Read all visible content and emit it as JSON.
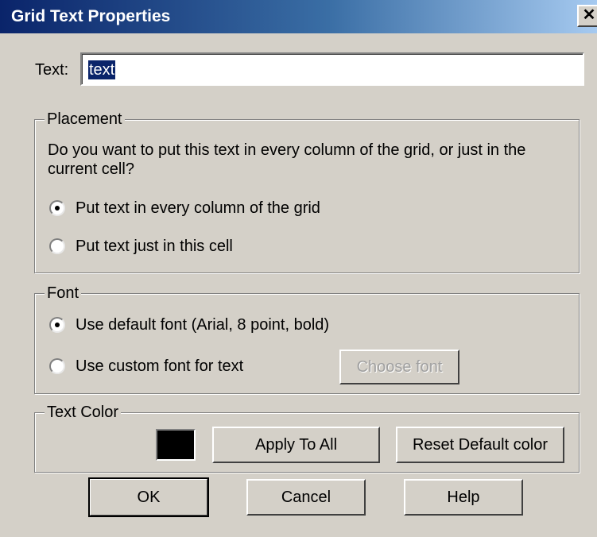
{
  "window": {
    "title": "Grid Text Properties",
    "close_glyph": "✕"
  },
  "text_field": {
    "label": "Text:",
    "value": "text"
  },
  "placement": {
    "title": "Placement",
    "question": [
      "Do you want to put this text in every column of the grid, or just in the",
      "current cell?"
    ],
    "options": [
      {
        "label": "Put text in every column of the grid",
        "selected": true
      },
      {
        "label": "Put text just in this cell",
        "selected": false
      }
    ]
  },
  "font": {
    "title": "Font",
    "options": [
      {
        "label": "Use default font (Arial, 8 point, bold)",
        "selected": true
      },
      {
        "label": "Use custom font for text",
        "selected": false
      }
    ],
    "choose_font_label": "Choose font",
    "choose_font_enabled": false
  },
  "text_color": {
    "title": "Text Color",
    "swatch_color": "#000000",
    "apply_all_label": "Apply To All",
    "reset_label": "Reset Default color"
  },
  "buttons": {
    "ok": "OK",
    "cancel": "Cancel",
    "help": "Help"
  },
  "colors": {
    "dialog_bg": "#d4d0c8",
    "title_bar_start": "#0a246a",
    "selection": "#0a246a"
  }
}
